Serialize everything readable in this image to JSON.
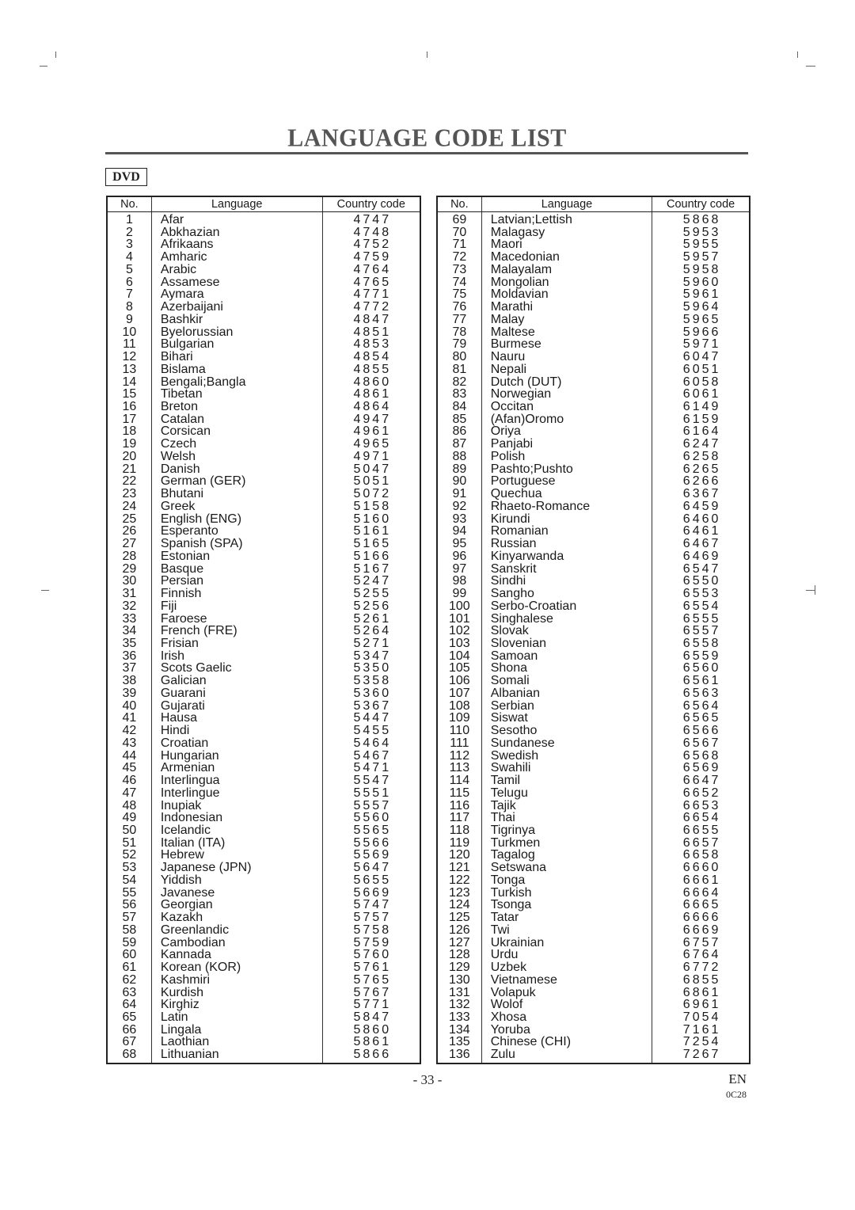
{
  "page": {
    "title": "LANGUAGE CODE LIST",
    "badge": "DVD",
    "page_number": "- 33 -",
    "language": "EN",
    "doc_code": "0C28"
  },
  "table": {
    "headers": [
      "No.",
      "Language",
      "Country code"
    ],
    "left_rows": [
      [
        "1",
        "Afar",
        "4747"
      ],
      [
        "2",
        "Abkhazian",
        "4748"
      ],
      [
        "3",
        "Afrikaans",
        "4752"
      ],
      [
        "4",
        "Amharic",
        "4759"
      ],
      [
        "5",
        "Arabic",
        "4764"
      ],
      [
        "6",
        "Assamese",
        "4765"
      ],
      [
        "7",
        "Aymara",
        "4771"
      ],
      [
        "8",
        "Azerbaijani",
        "4772"
      ],
      [
        "9",
        "Bashkir",
        "4847"
      ],
      [
        "10",
        "Byelorussian",
        "4851"
      ],
      [
        "11",
        "Bulgarian",
        "4853"
      ],
      [
        "12",
        "Bihari",
        "4854"
      ],
      [
        "13",
        "Bislama",
        "4855"
      ],
      [
        "14",
        "Bengali;Bangla",
        "4860"
      ],
      [
        "15",
        "Tibetan",
        "4861"
      ],
      [
        "16",
        "Breton",
        "4864"
      ],
      [
        "17",
        "Catalan",
        "4947"
      ],
      [
        "18",
        "Corsican",
        "4961"
      ],
      [
        "19",
        "Czech",
        "4965"
      ],
      [
        "20",
        "Welsh",
        "4971"
      ],
      [
        "21",
        "Danish",
        "5047"
      ],
      [
        "22",
        "German (GER)",
        "5051"
      ],
      [
        "23",
        "Bhutani",
        "5072"
      ],
      [
        "24",
        "Greek",
        "5158"
      ],
      [
        "25",
        "English (ENG)",
        "5160"
      ],
      [
        "26",
        "Esperanto",
        "5161"
      ],
      [
        "27",
        "Spanish (SPA)",
        "5165"
      ],
      [
        "28",
        "Estonian",
        "5166"
      ],
      [
        "29",
        "Basque",
        "5167"
      ],
      [
        "30",
        "Persian",
        "5247"
      ],
      [
        "31",
        "Finnish",
        "5255"
      ],
      [
        "32",
        "Fiji",
        "5256"
      ],
      [
        "33",
        "Faroese",
        "5261"
      ],
      [
        "34",
        "French (FRE)",
        "5264"
      ],
      [
        "35",
        "Frisian",
        "5271"
      ],
      [
        "36",
        "Irish",
        "5347"
      ],
      [
        "37",
        "Scots Gaelic",
        "5350"
      ],
      [
        "38",
        "Galician",
        "5358"
      ],
      [
        "39",
        "Guarani",
        "5360"
      ],
      [
        "40",
        "Gujarati",
        "5367"
      ],
      [
        "41",
        "Hausa",
        "5447"
      ],
      [
        "42",
        "Hindi",
        "5455"
      ],
      [
        "43",
        "Croatian",
        "5464"
      ],
      [
        "44",
        "Hungarian",
        "5467"
      ],
      [
        "45",
        "Armenian",
        "5471"
      ],
      [
        "46",
        "Interlingua",
        "5547"
      ],
      [
        "47",
        "Interlingue",
        "5551"
      ],
      [
        "48",
        "Inupiak",
        "5557"
      ],
      [
        "49",
        "Indonesian",
        "5560"
      ],
      [
        "50",
        "Icelandic",
        "5565"
      ],
      [
        "51",
        "Italian (ITA)",
        "5566"
      ],
      [
        "52",
        "Hebrew",
        "5569"
      ],
      [
        "53",
        "Japanese (JPN)",
        "5647"
      ],
      [
        "54",
        "Yiddish",
        "5655"
      ],
      [
        "55",
        "Javanese",
        "5669"
      ],
      [
        "56",
        "Georgian",
        "5747"
      ],
      [
        "57",
        "Kazakh",
        "5757"
      ],
      [
        "58",
        "Greenlandic",
        "5758"
      ],
      [
        "59",
        "Cambodian",
        "5759"
      ],
      [
        "60",
        "Kannada",
        "5760"
      ],
      [
        "61",
        "Korean (KOR)",
        "5761"
      ],
      [
        "62",
        "Kashmiri",
        "5765"
      ],
      [
        "63",
        "Kurdish",
        "5767"
      ],
      [
        "64",
        "Kirghiz",
        "5771"
      ],
      [
        "65",
        "Latin",
        "5847"
      ],
      [
        "66",
        "Lingala",
        "5860"
      ],
      [
        "67",
        "Laothian",
        "5861"
      ],
      [
        "68",
        "Lithuanian",
        "5866"
      ]
    ],
    "right_rows": [
      [
        "69",
        "Latvian;Lettish",
        "5868"
      ],
      [
        "70",
        "Malagasy",
        "5953"
      ],
      [
        "71",
        "Maori",
        "5955"
      ],
      [
        "72",
        "Macedonian",
        "5957"
      ],
      [
        "73",
        "Malayalam",
        "5958"
      ],
      [
        "74",
        "Mongolian",
        "5960"
      ],
      [
        "75",
        "Moldavian",
        "5961"
      ],
      [
        "76",
        "Marathi",
        "5964"
      ],
      [
        "77",
        "Malay",
        "5965"
      ],
      [
        "78",
        "Maltese",
        "5966"
      ],
      [
        "79",
        "Burmese",
        "5971"
      ],
      [
        "80",
        "Nauru",
        "6047"
      ],
      [
        "81",
        "Nepali",
        "6051"
      ],
      [
        "82",
        "Dutch (DUT)",
        "6058"
      ],
      [
        "83",
        "Norwegian",
        "6061"
      ],
      [
        "84",
        "Occitan",
        "6149"
      ],
      [
        "85",
        "(Afan)Oromo",
        "6159"
      ],
      [
        "86",
        "Oriya",
        "6164"
      ],
      [
        "87",
        "Panjabi",
        "6247"
      ],
      [
        "88",
        "Polish",
        "6258"
      ],
      [
        "89",
        "Pashto;Pushto",
        "6265"
      ],
      [
        "90",
        "Portuguese",
        "6266"
      ],
      [
        "91",
        "Quechua",
        "6367"
      ],
      [
        "92",
        "Rhaeto-Romance",
        "6459"
      ],
      [
        "93",
        "Kirundi",
        "6460"
      ],
      [
        "94",
        "Romanian",
        "6461"
      ],
      [
        "95",
        "Russian",
        "6467"
      ],
      [
        "96",
        "Kinyarwanda",
        "6469"
      ],
      [
        "97",
        "Sanskrit",
        "6547"
      ],
      [
        "98",
        "Sindhi",
        "6550"
      ],
      [
        "99",
        "Sangho",
        "6553"
      ],
      [
        "100",
        "Serbo-Croatian",
        "6554"
      ],
      [
        "101",
        "Singhalese",
        "6555"
      ],
      [
        "102",
        "Slovak",
        "6557"
      ],
      [
        "103",
        "Slovenian",
        "6558"
      ],
      [
        "104",
        "Samoan",
        "6559"
      ],
      [
        "105",
        "Shona",
        "6560"
      ],
      [
        "106",
        "Somali",
        "6561"
      ],
      [
        "107",
        "Albanian",
        "6563"
      ],
      [
        "108",
        "Serbian",
        "6564"
      ],
      [
        "109",
        "Siswat",
        "6565"
      ],
      [
        "110",
        "Sesotho",
        "6566"
      ],
      [
        "111",
        "Sundanese",
        "6567"
      ],
      [
        "112",
        "Swedish",
        "6568"
      ],
      [
        "113",
        "Swahili",
        "6569"
      ],
      [
        "114",
        "Tamil",
        "6647"
      ],
      [
        "115",
        "Telugu",
        "6652"
      ],
      [
        "116",
        "Tajik",
        "6653"
      ],
      [
        "117",
        "Thai",
        "6654"
      ],
      [
        "118",
        "Tigrinya",
        "6655"
      ],
      [
        "119",
        "Turkmen",
        "6657"
      ],
      [
        "120",
        "Tagalog",
        "6658"
      ],
      [
        "121",
        "Setswana",
        "6660"
      ],
      [
        "122",
        "Tonga",
        "6661"
      ],
      [
        "123",
        "Turkish",
        "6664"
      ],
      [
        "124",
        "Tsonga",
        "6665"
      ],
      [
        "125",
        "Tatar",
        "6666"
      ],
      [
        "126",
        "Twi",
        "6669"
      ],
      [
        "127",
        "Ukrainian",
        "6757"
      ],
      [
        "128",
        "Urdu",
        "6764"
      ],
      [
        "129",
        "Uzbek",
        "6772"
      ],
      [
        "130",
        "Vietnamese",
        "6855"
      ],
      [
        "131",
        "Volapuk",
        "6861"
      ],
      [
        "132",
        "Wolof",
        "6961"
      ],
      [
        "133",
        "Xhosa",
        "7054"
      ],
      [
        "134",
        "Yoruba",
        "7161"
      ],
      [
        "135",
        "Chinese (CHI)",
        "7254"
      ],
      [
        "136",
        "Zulu",
        "7267"
      ]
    ]
  }
}
